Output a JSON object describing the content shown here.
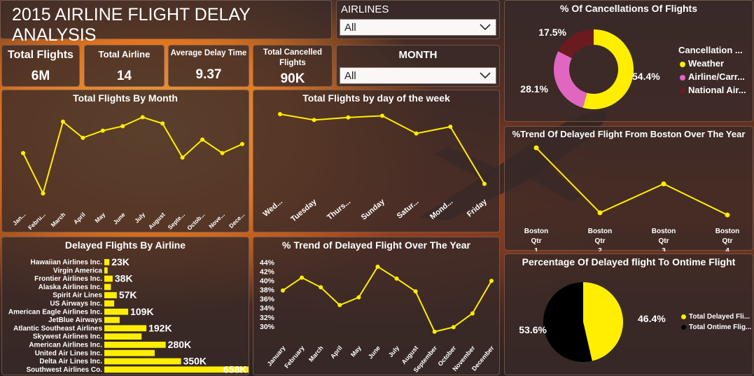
{
  "title": "2015 AIRLINE FLIGHT DELAY ANALYSIS",
  "filters": {
    "airlines": {
      "label": "AIRLINES",
      "value": "All"
    },
    "month": {
      "label": "MONTH",
      "value": "All"
    }
  },
  "kpis": [
    {
      "label": "Total Flights",
      "value": "6M"
    },
    {
      "label": "Total Airline",
      "value": "14"
    },
    {
      "label": "Average Delay Time",
      "value": "9.37"
    },
    {
      "label": "Total Cancelled Flights",
      "value": "90K"
    }
  ],
  "colors": {
    "accent": "#ffee00",
    "pink": "#e066c0",
    "maroon": "#6b1a20",
    "black": "#000000"
  },
  "chart_data": [
    {
      "id": "flights_by_month",
      "type": "line",
      "title": "Total Flights By Month",
      "categories": [
        "Jan...",
        "Febru...",
        "March",
        "April",
        "May",
        "June",
        "July",
        "August",
        "Septe...",
        "Octob...",
        "Nove...",
        "Dece..."
      ],
      "values": [
        0.55,
        0.1,
        0.9,
        0.72,
        0.8,
        0.85,
        0.95,
        0.88,
        0.5,
        0.7,
        0.55,
        0.65
      ]
    },
    {
      "id": "flights_by_day",
      "type": "line",
      "title": "Total Flights by day of the week",
      "categories": [
        "Wed...",
        "Tuesday",
        "Thurs...",
        "Sunday",
        "Satur...",
        "Mond...",
        "Friday"
      ],
      "values": [
        0.95,
        0.88,
        0.91,
        0.93,
        0.72,
        0.8,
        0.12
      ]
    },
    {
      "id": "boston_trend",
      "type": "line",
      "title": "%Trend Of Delayed Flight From Boston Over The Year",
      "categories": [
        "Boston Qtr 1",
        "Boston Qtr 2",
        "Boston Qtr 3",
        "Boston Qtr 4"
      ],
      "values": [
        0.95,
        0.05,
        0.45,
        0.02
      ]
    },
    {
      "id": "delayed_by_airline",
      "type": "bar",
      "title": "Delayed Flights By Airline",
      "categories": [
        "Hawaiian Airlines Inc.",
        "Virgin America",
        "Frontier Airlines Inc.",
        "Alaska Airlines Inc.",
        "Spirit Air Lines",
        "US Airways Inc.",
        "American Eagle Airlines Inc.",
        "JetBlue Airways",
        "Atlantic Southeast Airlines",
        "Skywest Airlines Inc.",
        "American Airlines Inc.",
        "United Air Lines Inc.",
        "Delta Air Lines Inc.",
        "Southwest Airlines Co."
      ],
      "values": [
        23,
        15,
        38,
        30,
        57,
        45,
        109,
        70,
        192,
        170,
        280,
        230,
        350,
        658
      ],
      "labels": [
        "23K",
        "",
        "38K",
        "",
        "57K",
        "",
        "109K",
        "",
        "192K",
        "",
        "280K",
        "",
        "350K",
        "658K"
      ]
    },
    {
      "id": "delay_trend_year",
      "type": "line",
      "title": "% Trend of Delayed Flight Over The Year",
      "categories": [
        "January",
        "February",
        "March",
        "April",
        "May",
        "June",
        "July",
        "August",
        "September",
        "October",
        "November",
        "December"
      ],
      "values": [
        37.8,
        40.6,
        38.5,
        34.6,
        36.3,
        43.0,
        40.4,
        37.6,
        28.8,
        29.8,
        32.8,
        39.9
      ],
      "yticks": [
        "30%",
        "32%",
        "34%",
        "36%",
        "38%",
        "40%",
        "42%",
        "44%"
      ],
      "ylim": [
        28,
        44.5
      ]
    },
    {
      "id": "cancellations",
      "type": "pie",
      "title": "% Of Cancellations Of Flights",
      "legend_title": "Cancellation ...",
      "slices": [
        {
          "name": "Weather",
          "value": 54.4,
          "label": "54.4%",
          "color": "#ffee00"
        },
        {
          "name": "Airline/Carr...",
          "value": 28.1,
          "label": "28.1%",
          "color": "#e066c0"
        },
        {
          "name": "National Air...",
          "value": 17.5,
          "label": "17.5%",
          "color": "#6b1a20"
        }
      ]
    },
    {
      "id": "delayed_vs_ontime",
      "type": "pie",
      "title": "Percentage Of Delayed flight To Ontime Flight",
      "slices": [
        {
          "name": "Total Delayed Fli...",
          "value": 46.4,
          "label": "46.4%",
          "color": "#ffee00"
        },
        {
          "name": "Total Ontime Flig...",
          "value": 53.6,
          "label": "53.6%",
          "color": "#000000"
        }
      ]
    }
  ]
}
